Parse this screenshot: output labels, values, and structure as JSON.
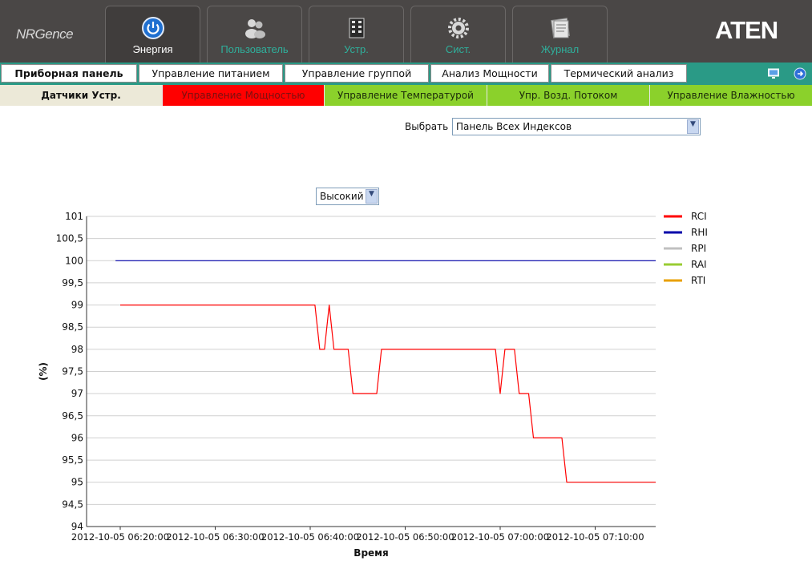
{
  "header": {
    "logo_left": "NRGence",
    "logo_right": "ATEN",
    "nav": [
      {
        "label": "Энергия",
        "icon": "power-icon",
        "active": true
      },
      {
        "label": "Пользователь",
        "icon": "users-icon",
        "active": false
      },
      {
        "label": "Устр.",
        "icon": "device-icon",
        "active": false
      },
      {
        "label": "Сист.",
        "icon": "gear-icon",
        "active": false
      },
      {
        "label": "Журнал",
        "icon": "log-icon",
        "active": false
      }
    ]
  },
  "tabs_row1": [
    {
      "label": "Приборная панель",
      "active": true
    },
    {
      "label": "Управление питанием",
      "active": false
    },
    {
      "label": "Управление группой",
      "active": false
    },
    {
      "label": "Анализ Мощности",
      "active": false
    },
    {
      "label": "Термический анализ",
      "active": false
    }
  ],
  "tabs_row2": [
    {
      "label": "Датчики Устр.",
      "bg": "#ece9d8",
      "color": "#111111",
      "bold": true
    },
    {
      "label": "Управление Мощностью",
      "bg": "#ff0000",
      "color": "#7a1010",
      "bold": false
    },
    {
      "label": "Управление Температурой",
      "bg": "#8bd12b",
      "color": "#1a2a0a",
      "bold": false
    },
    {
      "label": "Упр. Возд. Потоком",
      "bg": "#8bd12b",
      "color": "#1a2a0a",
      "bold": false
    },
    {
      "label": "Управление Влажностью",
      "bg": "#8bd12b",
      "color": "#1a2a0a",
      "bold": false
    }
  ],
  "select": {
    "label": "Выбрать",
    "value": "Панель Всех Индексов"
  },
  "level_select": {
    "value": "Высокий"
  },
  "chart_data": {
    "type": "line",
    "xlabel": "Время",
    "ylabel": "(%)",
    "ylim": [
      94,
      101
    ],
    "yticks": [
      {
        "v": 101,
        "label": "101"
      },
      {
        "v": 100.5,
        "label": "100,5"
      },
      {
        "v": 100,
        "label": "100"
      },
      {
        "v": 99.5,
        "label": "99,5"
      },
      {
        "v": 99,
        "label": "99"
      },
      {
        "v": 98.5,
        "label": "98,5"
      },
      {
        "v": 98,
        "label": "98"
      },
      {
        "v": 97.5,
        "label": "97,5"
      },
      {
        "v": 97,
        "label": "97"
      },
      {
        "v": 96.5,
        "label": "96,5"
      },
      {
        "v": 96,
        "label": "96"
      },
      {
        "v": 95.5,
        "label": "95,5"
      },
      {
        "v": 95,
        "label": "95"
      },
      {
        "v": 94.5,
        "label": "94,5"
      },
      {
        "v": 94,
        "label": "94"
      }
    ],
    "xlim": [
      "2012-10-05 06:20:00",
      "2012-10-05 07:18:00"
    ],
    "xticks": [
      "2012-10-05 06:20:00",
      "2012-10-05 06:30:00",
      "2012-10-05 06:40:00",
      "2012-10-05 06:50:00",
      "2012-10-05 07:00:00",
      "2012-10-05 07:10:00"
    ],
    "grid": true,
    "legend": "right",
    "series": [
      {
        "name": "RCI",
        "color": "#ff0000",
        "points": [
          [
            "2012-10-05 06:20:00",
            99
          ],
          [
            "2012-10-05 06:40:30",
            99
          ],
          [
            "2012-10-05 06:41:00",
            98
          ],
          [
            "2012-10-05 06:41:30",
            98
          ],
          [
            "2012-10-05 06:42:00",
            99
          ],
          [
            "2012-10-05 06:42:30",
            98
          ],
          [
            "2012-10-05 06:44:00",
            98
          ],
          [
            "2012-10-05 06:44:30",
            97
          ],
          [
            "2012-10-05 06:47:00",
            97
          ],
          [
            "2012-10-05 06:47:30",
            98
          ],
          [
            "2012-10-05 06:59:30",
            98
          ],
          [
            "2012-10-05 07:00:00",
            97
          ],
          [
            "2012-10-05 07:00:30",
            98
          ],
          [
            "2012-10-05 07:01:30",
            98
          ],
          [
            "2012-10-05 07:02:00",
            97
          ],
          [
            "2012-10-05 07:03:00",
            97
          ],
          [
            "2012-10-05 07:03:30",
            96
          ],
          [
            "2012-10-05 07:06:30",
            96
          ],
          [
            "2012-10-05 07:07:00",
            95
          ],
          [
            "2012-10-05 07:18:00",
            95
          ]
        ]
      },
      {
        "name": "RHI",
        "color": "#0000aa",
        "points": [
          [
            "2012-10-05 06:19:30",
            100
          ],
          [
            "2012-10-05 07:18:00",
            100
          ]
        ]
      },
      {
        "name": "RPI",
        "color": "#c0c0c0",
        "points": []
      },
      {
        "name": "RAI",
        "color": "#99cc33",
        "points": []
      },
      {
        "name": "RTI",
        "color": "#e8a000",
        "points": []
      }
    ]
  }
}
